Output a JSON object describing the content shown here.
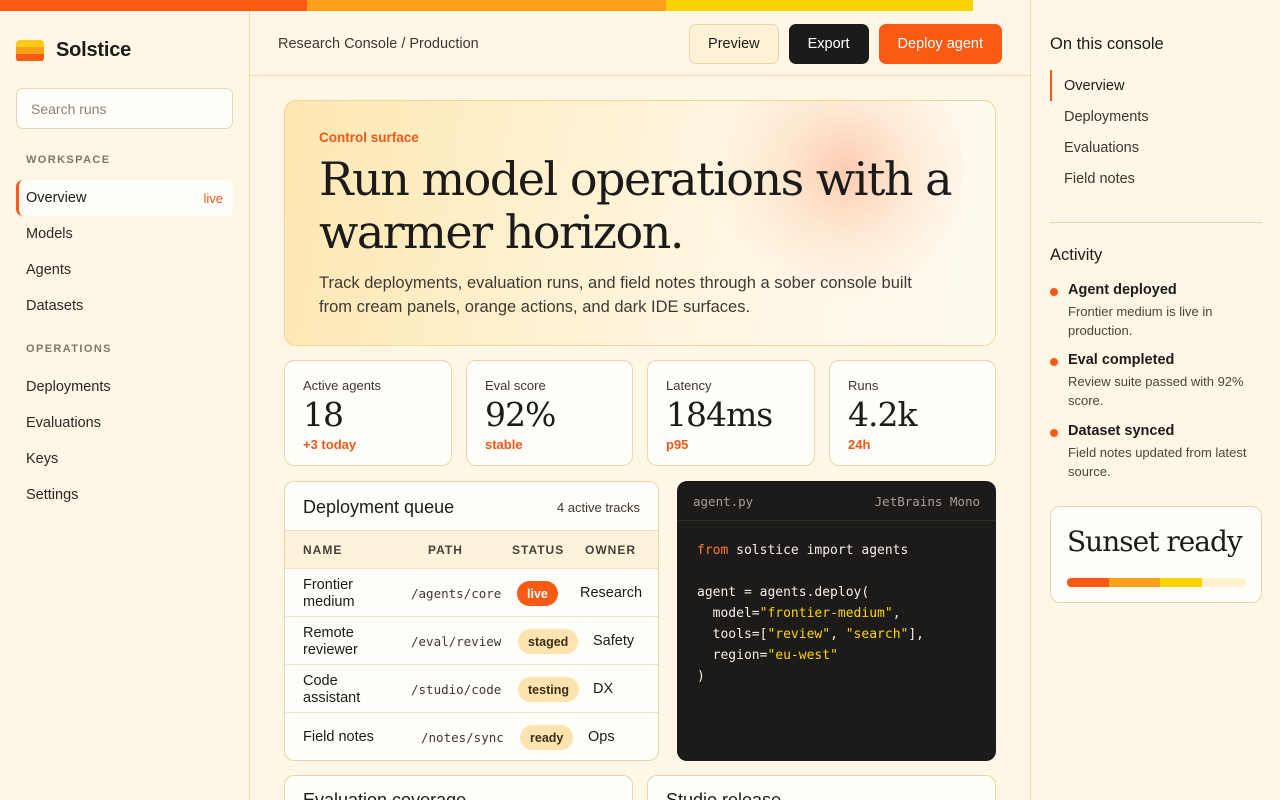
{
  "brand": {
    "name": "Solstice",
    "logo_colors": [
      "#ffcb14",
      "#ff9f1a",
      "#fa5a14"
    ]
  },
  "top_stripe_colors": [
    "#fa5a14",
    "#ff9f1a",
    "#fbd400"
  ],
  "sidebar": {
    "search_placeholder": "Search runs",
    "workspace_heading": "WORKSPACE",
    "workspace_items": [
      {
        "label": "Overview",
        "badge": "live",
        "active": true
      },
      {
        "label": "Models"
      },
      {
        "label": "Agents"
      },
      {
        "label": "Datasets"
      }
    ],
    "operations_heading": "OPERATIONS",
    "operations_items": [
      {
        "label": "Deployments"
      },
      {
        "label": "Evaluations"
      },
      {
        "label": "Keys"
      },
      {
        "label": "Settings"
      }
    ]
  },
  "header": {
    "breadcrumb": "Research Console / Production",
    "preview_label": "Preview",
    "export_label": "Export",
    "deploy_label": "Deploy agent"
  },
  "hero": {
    "eyebrow": "Control surface",
    "title": "Run model operations with a warmer horizon.",
    "description": "Track deployments, evaluation runs, and field notes through a sober console built from cream panels, orange actions, and dark IDE surfaces."
  },
  "stats": [
    {
      "label": "Active agents",
      "value": "18",
      "sub": "+3 today"
    },
    {
      "label": "Eval score",
      "value": "92%",
      "sub": "stable"
    },
    {
      "label": "Latency",
      "value": "184ms",
      "sub": "p95"
    },
    {
      "label": "Runs",
      "value": "4.2k",
      "sub": "24h"
    }
  ],
  "queue": {
    "title": "Deployment queue",
    "meta": "4 active tracks",
    "columns": [
      "NAME",
      "PATH",
      "STATUS",
      "OWNER"
    ],
    "rows": [
      {
        "name": "Frontier medium",
        "path": "/agents/core",
        "status": "live",
        "owner": "Research"
      },
      {
        "name": "Remote reviewer",
        "path": "/eval/review",
        "status": "staged",
        "owner": "Safety"
      },
      {
        "name": "Code assistant",
        "path": "/studio/code",
        "status": "testing",
        "owner": "DX"
      },
      {
        "name": "Field notes",
        "path": "/notes/sync",
        "status": "ready",
        "owner": "Ops"
      }
    ]
  },
  "code": {
    "filename": "agent.py",
    "font_label": "JetBrains Mono",
    "lines": [
      [
        {
          "t": "from",
          "c": "kw"
        },
        {
          "t": " solstice import agents"
        }
      ],
      [],
      [
        {
          "t": "agent = agents.deploy("
        }
      ],
      [
        {
          "t": "  model="
        },
        {
          "t": "\"frontier-medium\"",
          "c": "str"
        },
        {
          "t": ","
        }
      ],
      [
        {
          "t": "  tools=["
        },
        {
          "t": "\"review\"",
          "c": "str"
        },
        {
          "t": ", "
        },
        {
          "t": "\"search\"",
          "c": "str"
        },
        {
          "t": "],"
        }
      ],
      [
        {
          "t": "  region="
        },
        {
          "t": "\"eu-west\"",
          "c": "str"
        }
      ],
      [
        {
          "t": ")"
        }
      ]
    ]
  },
  "bottom_cards": [
    {
      "title": "Evaluation coverage"
    },
    {
      "title": "Studio release"
    }
  ],
  "rail": {
    "toc_title": "On this console",
    "toc_items": [
      {
        "label": "Overview",
        "active": true
      },
      {
        "label": "Deployments"
      },
      {
        "label": "Evaluations"
      },
      {
        "label": "Field notes"
      }
    ],
    "activity_title": "Activity",
    "activity": [
      {
        "title": "Agent deployed",
        "detail": "Frontier medium is live in production."
      },
      {
        "title": "Eval completed",
        "detail": "Review suite passed with 92% score."
      },
      {
        "title": "Dataset synced",
        "detail": "Field notes updated from latest source."
      }
    ],
    "sunset_title": "Sunset ready",
    "sunset_bar_colors": [
      "#fa5a14",
      "#ff9f1a",
      "#fbd400"
    ]
  }
}
